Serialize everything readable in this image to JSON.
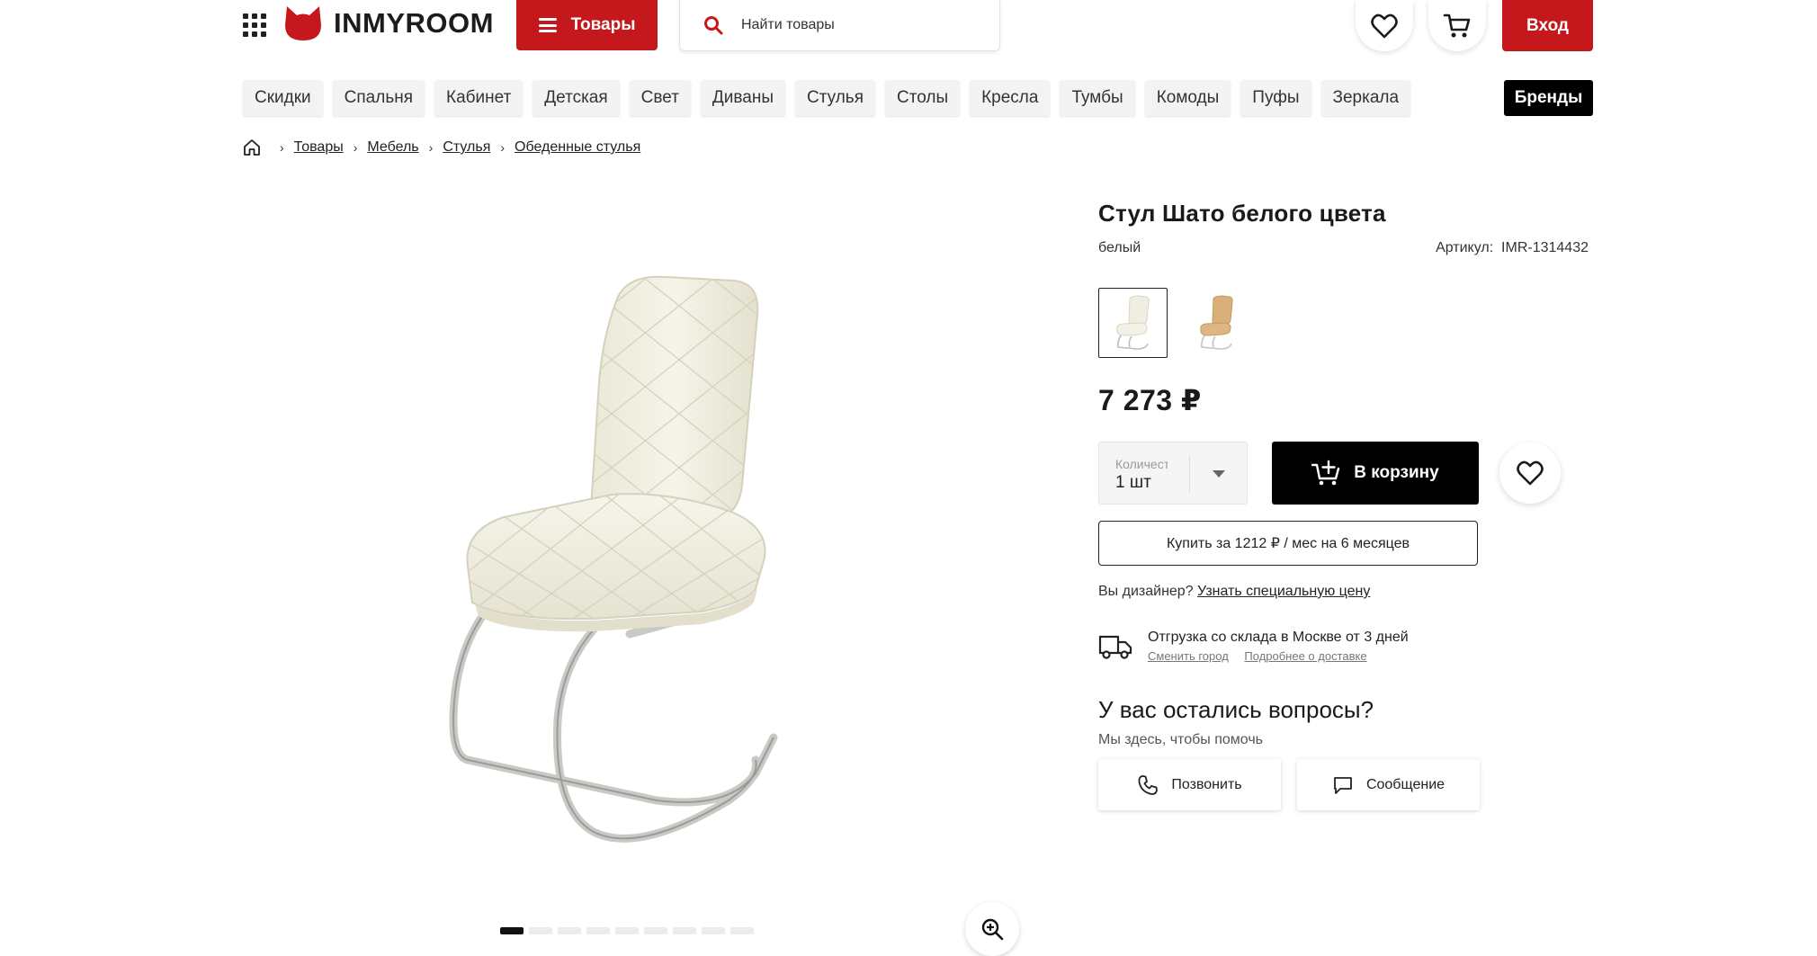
{
  "header": {
    "logo_text": "INMYROOM",
    "catalog_label": "Товары",
    "search_placeholder": "Найти товары",
    "login_label": "Вход"
  },
  "categories": [
    "Скидки",
    "Спальня",
    "Кабинет",
    "Детская",
    "Свет",
    "Диваны",
    "Стулья",
    "Столы",
    "Кресла",
    "Тумбы",
    "Комоды",
    "Пуфы",
    "Зеркала"
  ],
  "brands_label": "Бренды",
  "breadcrumbs": [
    "Товары",
    "Мебель",
    "Стулья",
    "Обеденные стулья"
  ],
  "gallery": {
    "slide_count": 9,
    "active_slide": 1
  },
  "product": {
    "title": "Стул Шато белого цвета",
    "color": "белый",
    "sku_label": "Артикул:",
    "sku": "IMR-1314432",
    "variants": [
      "white",
      "beige"
    ],
    "price": "7 273 ₽",
    "qty_label": "Количество",
    "qty_value": "1 шт",
    "cart_label": "В корзину",
    "credit_label": "Купить за 1212 ₽ / мес на 6 месяцев",
    "designer_question": "Вы дизайнер?",
    "designer_link": "Узнать специальную цену",
    "delivery_title": "Отгрузка со склада в Москве от 3 дней",
    "change_city": "Сменить город",
    "delivery_more": "Подробнее о доставке"
  },
  "help": {
    "title": "У вас остались вопросы?",
    "subtitle": "Мы здесь, чтобы помочь",
    "call_label": "Позвонить",
    "message_label": "Сообщение"
  },
  "colors": {
    "brand_red": "#c5181d",
    "black": "#000000",
    "chair_white": "#f1efe2",
    "chair_beige": "#d9b07a"
  }
}
